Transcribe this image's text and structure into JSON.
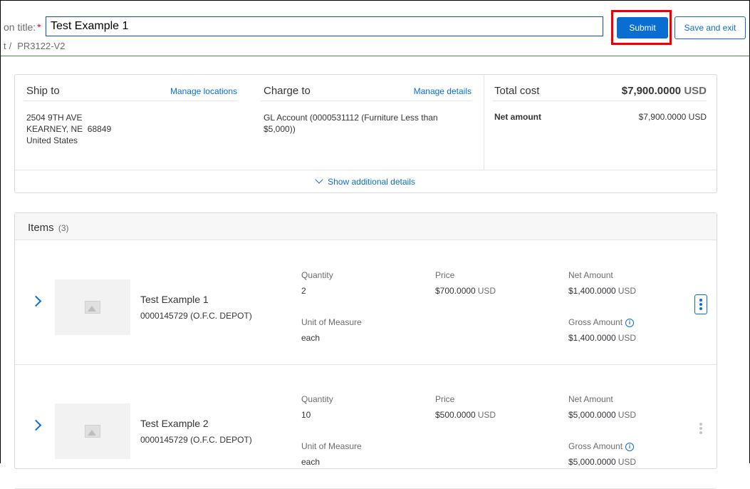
{
  "header": {
    "title_label": "on title:",
    "required_mark": "*",
    "title_value": "Test Example 1",
    "breadcrumb_prefix": "t",
    "breadcrumb_separator": "/",
    "breadcrumb_id": "PR3122-V2",
    "submit_label": "Submit",
    "save_exit_label": "Save and exit"
  },
  "ship_to": {
    "title": "Ship to",
    "link": "Manage locations",
    "address_line1": "2504 9TH AVE",
    "address_line2": "KEARNEY, NE  68849",
    "address_line3": "United States"
  },
  "charge_to": {
    "title": "Charge to",
    "link": "Manage details",
    "text": "GL Account (0000531112 (Furniture Less than $5,000))"
  },
  "total": {
    "title": "Total cost",
    "amount": "$7,900.0000",
    "currency": "USD",
    "net_label": "Net amount",
    "net_value": "$7,900.0000 USD"
  },
  "show_more": "Show additional details",
  "items": {
    "title": "Items",
    "count": "(3)",
    "rows": [
      {
        "name": "Test Example 1",
        "supplier": "0000145729 (O.F.C. DEPOT)",
        "quantity_label": "Quantity",
        "quantity": "2",
        "uom_label": "Unit of Measure",
        "uom": "each",
        "price_label": "Price",
        "price": "$700.0000",
        "price_currency": "USD",
        "net_label": "Net Amount",
        "net": "$1,400.0000",
        "net_currency": "USD",
        "gross_label": "Gross Amount",
        "gross": "$1,400.0000",
        "gross_currency": "USD"
      },
      {
        "name": "Test Example 2",
        "supplier": "0000145729 (O.F.C. DEPOT)",
        "quantity_label": "Quantity",
        "quantity": "10",
        "uom_label": "Unit of Measure",
        "uom": "each",
        "price_label": "Price",
        "price": "$500.0000",
        "price_currency": "USD",
        "net_label": "Net Amount",
        "net": "$5,000.0000",
        "net_currency": "USD",
        "gross_label": "Gross Amount",
        "gross": "$5,000.0000",
        "gross_currency": "USD"
      }
    ]
  },
  "icons": {
    "info": "info-icon",
    "expand": "chevron-right-icon",
    "more": "more-vertical-icon",
    "image_placeholder": "image-placeholder-icon"
  },
  "colors": {
    "accent": "#0a6ed1",
    "highlight": "#ee0000"
  }
}
